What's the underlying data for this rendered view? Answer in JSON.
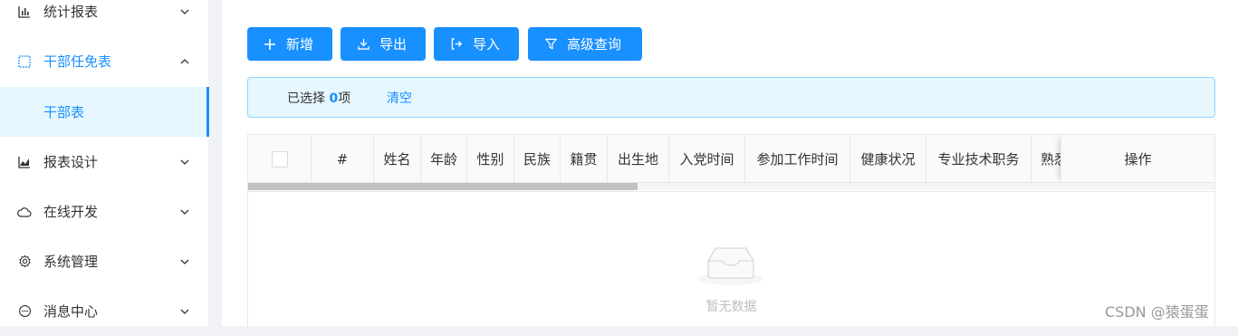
{
  "sidebar": {
    "items": [
      {
        "label": "统计报表",
        "icon": "bar-chart-icon",
        "state": "collapsed"
      },
      {
        "label": "干部任免表",
        "icon": "table-icon",
        "state": "open"
      },
      {
        "label": "干部表",
        "icon": "",
        "state": "selected"
      },
      {
        "label": "报表设计",
        "icon": "area-chart-icon",
        "state": "collapsed"
      },
      {
        "label": "在线开发",
        "icon": "cloud-icon",
        "state": "collapsed"
      },
      {
        "label": "系统管理",
        "icon": "gear-icon",
        "state": "collapsed"
      },
      {
        "label": "消息中心",
        "icon": "message-icon",
        "state": "collapsed"
      }
    ]
  },
  "toolbar": {
    "add_label": "新增",
    "export_label": "导出",
    "import_label": "导入",
    "advanced_query_label": "高级查询"
  },
  "alert": {
    "prefix": "已选择",
    "count": "0",
    "suffix": "项",
    "clear_label": "清空"
  },
  "table": {
    "columns": [
      "#",
      "姓名",
      "年龄",
      "性别",
      "民族",
      "籍贯",
      "出生地",
      "入党时间",
      "参加工作时间",
      "健康状况",
      "专业技术职务",
      "熟悉"
    ],
    "action_column": "操作",
    "empty_text": "暂无数据"
  },
  "watermark": "CSDN @猿蛋蛋",
  "colors": {
    "accent": "#1890ff",
    "alert_bg": "#e6f7ff",
    "alert_border": "#91d5ff"
  }
}
